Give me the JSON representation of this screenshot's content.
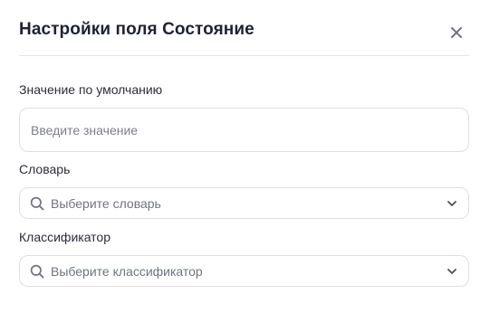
{
  "dialog": {
    "title": "Настройки поля Состояние",
    "close_icon": "close-icon"
  },
  "default_value": {
    "label": "Значение по умолчанию",
    "placeholder": "Введите значение",
    "value": ""
  },
  "dictionary": {
    "label": "Словарь",
    "placeholder": "Выберите словарь",
    "icon": "search-icon",
    "dropdown_icon": "chevron-down-icon"
  },
  "classifier": {
    "label": "Классификатор",
    "placeholder": "Выберите классификатор",
    "icon": "search-icon",
    "dropdown_icon": "chevron-down-icon"
  },
  "colors": {
    "title": "#1f2236",
    "border": "#dcdfe5",
    "placeholder": "#7a7f8c",
    "icon": "#6f7482"
  }
}
